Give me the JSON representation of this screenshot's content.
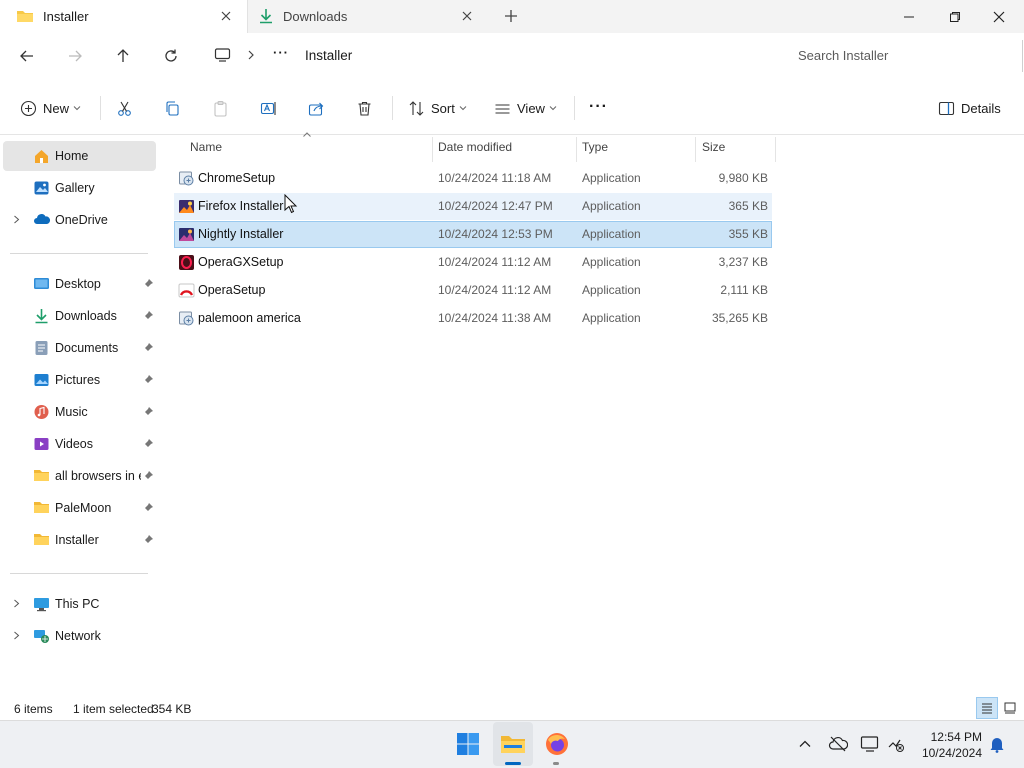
{
  "tabs": [
    {
      "label": "Installer",
      "active": true
    },
    {
      "label": "Downloads",
      "active": false
    }
  ],
  "address": {
    "overflow": "···",
    "current_folder": "Installer",
    "search_placeholder": "Search Installer"
  },
  "commands": {
    "new": "New",
    "sort": "Sort",
    "view": "View",
    "more": "···",
    "details": "Details"
  },
  "sidebar": {
    "items": [
      {
        "label": "Home",
        "icon": "home-icon",
        "selected": true
      },
      {
        "label": "Gallery",
        "icon": "gallery-icon"
      },
      {
        "label": "OneDrive",
        "icon": "onedrive-icon",
        "expandable": true
      },
      {
        "label": "Desktop",
        "icon": "desktop-icon",
        "pinned": true
      },
      {
        "label": "Downloads",
        "icon": "download-icon",
        "pinned": true
      },
      {
        "label": "Documents",
        "icon": "documents-icon",
        "pinned": true
      },
      {
        "label": "Pictures",
        "icon": "pictures-icon",
        "pinned": true
      },
      {
        "label": "Music",
        "icon": "music-icon",
        "pinned": true
      },
      {
        "label": "Videos",
        "icon": "videos-icon",
        "pinned": true
      },
      {
        "label": "all browsers in e",
        "icon": "folder-icon",
        "pinned": true
      },
      {
        "label": "PaleMoon",
        "icon": "folder-icon",
        "pinned": true
      },
      {
        "label": "Installer",
        "icon": "folder-icon",
        "pinned": true
      },
      {
        "label": "This PC",
        "icon": "pc-icon",
        "expandable": true
      },
      {
        "label": "Network",
        "icon": "network-icon",
        "expandable": true
      }
    ]
  },
  "columns": {
    "name": "Name",
    "date": "Date modified",
    "type": "Type",
    "size": "Size"
  },
  "files": [
    {
      "name": "ChromeSetup",
      "date": "10/24/2024 11:18 AM",
      "type": "Application",
      "size": "9,980 KB",
      "icon": "installer-generic-icon"
    },
    {
      "name": "Firefox Installer",
      "date": "10/24/2024 12:47 PM",
      "type": "Application",
      "size": "365 KB",
      "icon": "firefox-installer-icon",
      "hover": true
    },
    {
      "name": "Nightly Installer",
      "date": "10/24/2024 12:53 PM",
      "type": "Application",
      "size": "355 KB",
      "icon": "nightly-installer-icon",
      "selected": true
    },
    {
      "name": "OperaGXSetup",
      "date": "10/24/2024 11:12 AM",
      "type": "Application",
      "size": "3,237 KB",
      "icon": "operagx-icon"
    },
    {
      "name": "OperaSetup",
      "date": "10/24/2024 11:12 AM",
      "type": "Application",
      "size": "2,111 KB",
      "icon": "opera-icon"
    },
    {
      "name": "palemoon america",
      "date": "10/24/2024 11:38 AM",
      "type": "Application",
      "size": "35,265 KB",
      "icon": "installer-generic-icon"
    }
  ],
  "status": {
    "item_count": "6 items",
    "selection": "1 item selected",
    "selection_size": "354 KB"
  },
  "taskbar": {
    "time": "12:54 PM",
    "date": "10/24/2024"
  },
  "colors": {
    "selected_row": "#cce4f7",
    "hover_row": "#e9f2fb",
    "accent": "#0067c0"
  }
}
